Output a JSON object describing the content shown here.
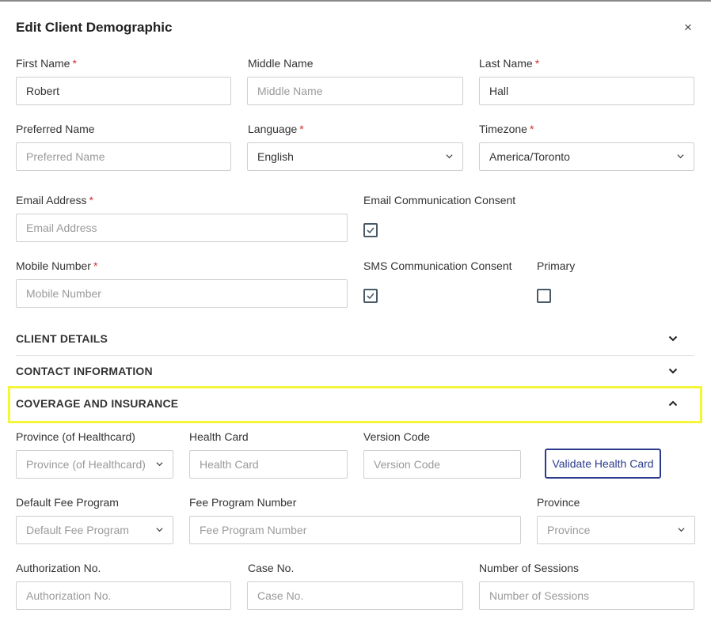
{
  "dialog": {
    "title": "Edit Client Demographic",
    "close_glyph": "×"
  },
  "fields": {
    "first_name": {
      "label": "First Name",
      "value": "Robert",
      "required": "*"
    },
    "middle_name": {
      "label": "Middle Name",
      "placeholder": "Middle Name"
    },
    "last_name": {
      "label": "Last Name",
      "value": "Hall",
      "required": "*"
    },
    "preferred_name": {
      "label": "Preferred Name",
      "placeholder": "Preferred Name"
    },
    "language": {
      "label": "Language",
      "value": "English",
      "required": "*"
    },
    "timezone": {
      "label": "Timezone",
      "value": "America/Toronto",
      "required": "*"
    },
    "email": {
      "label": "Email Address",
      "placeholder": "Email Address",
      "required": "*"
    },
    "email_consent": {
      "label": "Email Communication Consent",
      "checked": true
    },
    "mobile": {
      "label": "Mobile Number",
      "placeholder": "Mobile Number",
      "required": "*"
    },
    "sms_consent": {
      "label": "SMS Communication Consent",
      "checked": true
    },
    "primary": {
      "label": "Primary",
      "checked": false
    }
  },
  "sections": {
    "client_details": "CLIENT DETAILS",
    "contact_information": "CONTACT INFORMATION",
    "coverage_insurance": "COVERAGE AND INSURANCE"
  },
  "coverage": {
    "province_healthcard": {
      "label": "Province (of Healthcard)",
      "placeholder": "Province (of Healthcard)"
    },
    "health_card": {
      "label": "Health Card",
      "placeholder": "Health Card"
    },
    "version_code": {
      "label": "Version Code",
      "placeholder": "Version Code"
    },
    "validate_button": "Validate Health Card",
    "default_fee_program": {
      "label": "Default Fee Program",
      "placeholder": "Default Fee Program"
    },
    "fee_program_number": {
      "label": "Fee Program Number",
      "placeholder": "Fee Program Number"
    },
    "province": {
      "label": "Province",
      "placeholder": "Province"
    },
    "authorization_no": {
      "label": "Authorization No.",
      "placeholder": "Authorization No."
    },
    "case_no": {
      "label": "Case No.",
      "placeholder": "Case No."
    },
    "number_of_sessions": {
      "label": "Number of Sessions",
      "placeholder": "Number of Sessions"
    }
  },
  "colors": {
    "required": "#d32f2f",
    "highlight": "#f5f53a",
    "button_accent": "#2b3a8c",
    "checkbox_border": "#4a5a66"
  },
  "icons": {
    "close": "close-icon",
    "chevron_down": "chevron-down-icon",
    "chevron_up": "chevron-up-icon",
    "check": "check-icon"
  }
}
